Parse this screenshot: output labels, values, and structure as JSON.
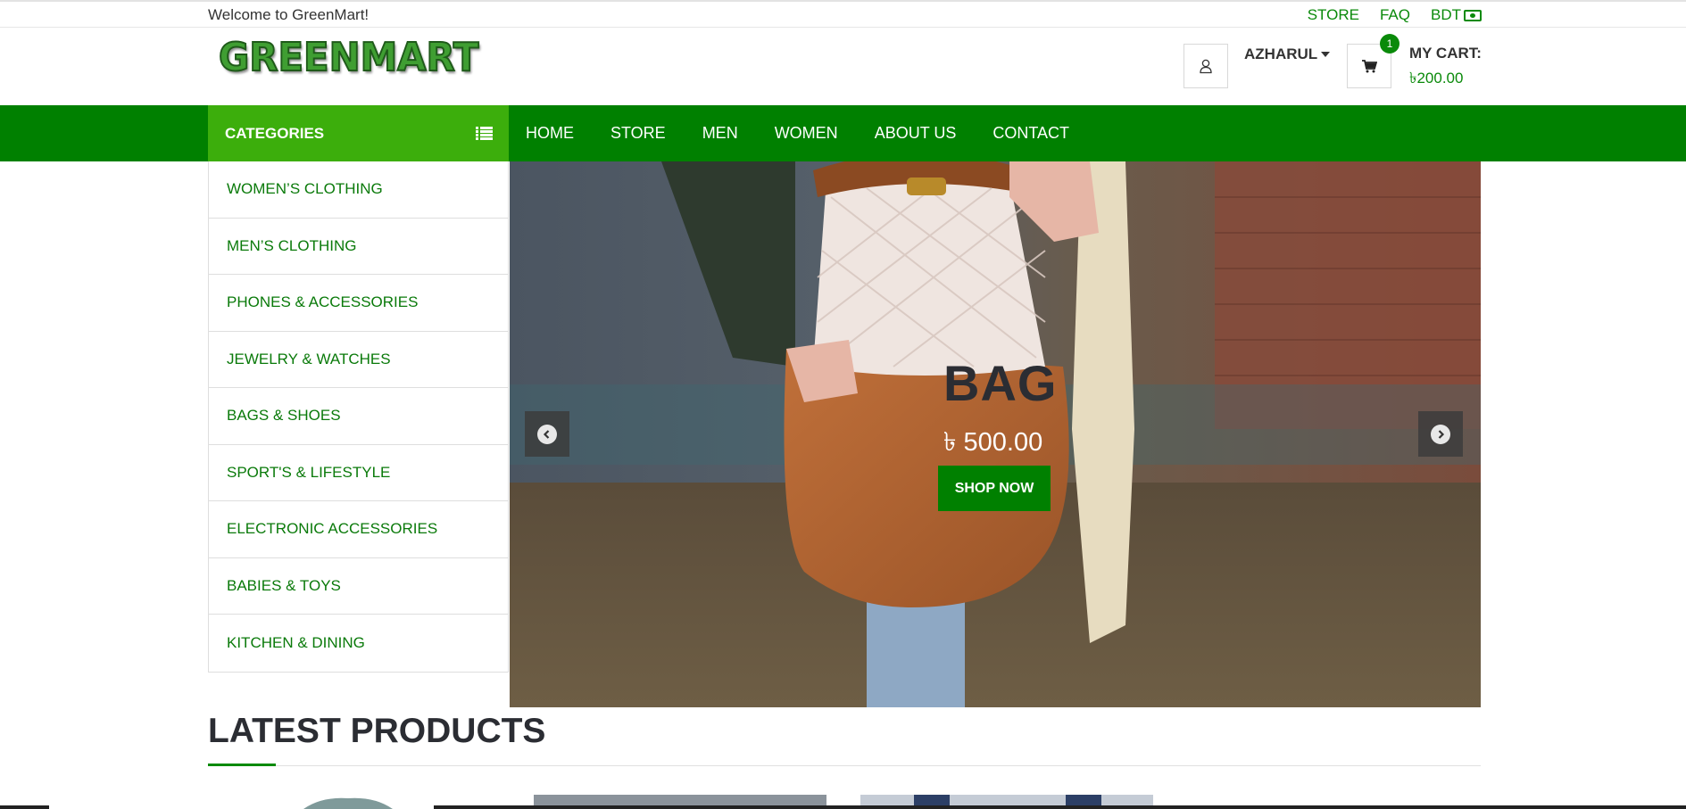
{
  "topbar": {
    "welcome": "Welcome to GreenMart!",
    "links": [
      "STORE",
      "FAQ"
    ],
    "currency": "BDT",
    "currency_icon": "money-icon"
  },
  "header": {
    "logo": "GREENMART",
    "user_name": "AZHARUL",
    "cart_count": "1",
    "cart_label": "MY CART:",
    "cart_total": "৳200.00"
  },
  "nav": {
    "categories_label": "CATEGORIES",
    "menu": [
      "HOME",
      "STORE",
      "MEN",
      "WOMEN",
      "ABOUT US",
      "CONTACT"
    ]
  },
  "sidebar": {
    "items": [
      "WOMEN’S CLOTHING",
      "MEN’S CLOTHING",
      "PHONES & ACCESSORIES",
      "JEWELRY & WATCHES",
      "BAGS & SHOES",
      "SPORT'S & LIFESTYLE",
      "ELECTRONIC ACCESSORIES",
      "BABIES & TOYS",
      "KITCHEN & DINING"
    ]
  },
  "slider": {
    "title": "BAG",
    "price": "৳ 500.00",
    "button": "SHOP NOW"
  },
  "latest": {
    "heading": "LATEST PRODUCTS"
  },
  "colors": {
    "brand_green": "#008000",
    "category_green": "#3cae0c",
    "link_green": "#0a8a0a"
  }
}
